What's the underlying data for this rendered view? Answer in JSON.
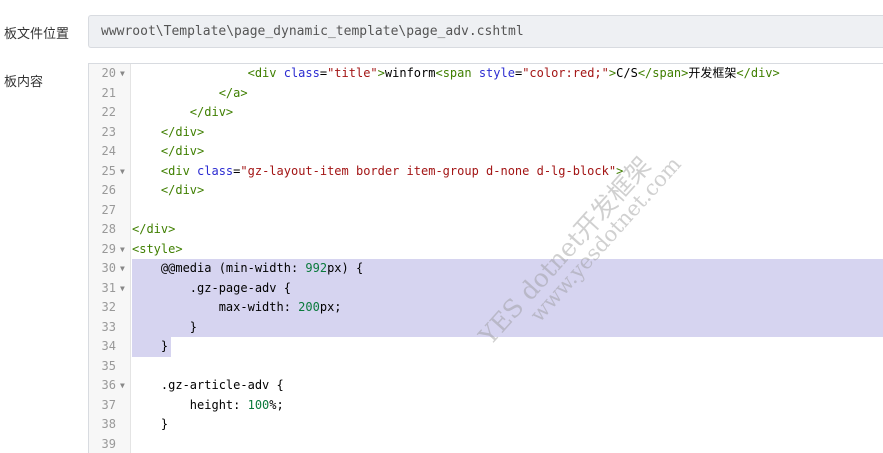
{
  "form": {
    "file_location_label": "板文件位置",
    "file_path": "wwwroot\\Template\\page_dynamic_template\\page_adv.cshtml",
    "content_label": "板内容"
  },
  "editor": {
    "selection_color": "#d6d4f0",
    "lines": [
      {
        "n": "20",
        "fold": true,
        "parts": [
          {
            "c": "t-txt",
            "t": "                "
          },
          {
            "c": "t-tag",
            "t": "<div "
          },
          {
            "c": "t-attr",
            "t": "class"
          },
          {
            "c": "t-txt",
            "t": "="
          },
          {
            "c": "t-str",
            "t": "\"title\""
          },
          {
            "c": "t-tag",
            "t": ">"
          },
          {
            "c": "t-txt",
            "t": "winform"
          },
          {
            "c": "t-tag",
            "t": "<span "
          },
          {
            "c": "t-attr",
            "t": "style"
          },
          {
            "c": "t-txt",
            "t": "="
          },
          {
            "c": "t-str",
            "t": "\"color:red;\""
          },
          {
            "c": "t-tag",
            "t": ">"
          },
          {
            "c": "t-txt",
            "t": "C/S"
          },
          {
            "c": "t-tag",
            "t": "</span>"
          },
          {
            "c": "t-txt",
            "t": "开发框架"
          },
          {
            "c": "t-tag",
            "t": "</div>"
          }
        ]
      },
      {
        "n": "21",
        "fold": false,
        "parts": [
          {
            "c": "t-txt",
            "t": "            "
          },
          {
            "c": "t-tag",
            "t": "</a>"
          }
        ]
      },
      {
        "n": "22",
        "fold": false,
        "parts": [
          {
            "c": "t-txt",
            "t": "        "
          },
          {
            "c": "t-tag",
            "t": "</div>"
          }
        ]
      },
      {
        "n": "23",
        "fold": false,
        "parts": [
          {
            "c": "t-txt",
            "t": "    "
          },
          {
            "c": "t-tag",
            "t": "</div>"
          }
        ]
      },
      {
        "n": "24",
        "fold": false,
        "parts": [
          {
            "c": "t-txt",
            "t": "    "
          },
          {
            "c": "t-tag",
            "t": "</div>"
          }
        ]
      },
      {
        "n": "25",
        "fold": true,
        "parts": [
          {
            "c": "t-txt",
            "t": "    "
          },
          {
            "c": "t-tag",
            "t": "<div "
          },
          {
            "c": "t-attr",
            "t": "class"
          },
          {
            "c": "t-txt",
            "t": "="
          },
          {
            "c": "t-str",
            "t": "\"gz-layout-item border item-group d-none d-lg-block\""
          },
          {
            "c": "t-tag",
            "t": ">"
          }
        ]
      },
      {
        "n": "26",
        "fold": false,
        "parts": [
          {
            "c": "t-txt",
            "t": "    "
          },
          {
            "c": "t-tag",
            "t": "</div>"
          }
        ]
      },
      {
        "n": "27",
        "fold": false,
        "parts": []
      },
      {
        "n": "28",
        "fold": false,
        "parts": [
          {
            "c": "t-tag",
            "t": "</div>"
          }
        ]
      },
      {
        "n": "29",
        "fold": true,
        "parts": [
          {
            "c": "t-tag",
            "t": "<style>"
          }
        ]
      },
      {
        "n": "30",
        "fold": true,
        "sel": true,
        "parts": [
          {
            "c": "t-txt",
            "t": "    @@media (min-width: "
          },
          {
            "c": "t-num",
            "t": "992"
          },
          {
            "c": "t-txt",
            "t": "px) {"
          }
        ]
      },
      {
        "n": "31",
        "fold": true,
        "sel": true,
        "parts": [
          {
            "c": "t-txt",
            "t": "        .gz-page-adv {"
          }
        ]
      },
      {
        "n": "32",
        "fold": false,
        "sel": true,
        "parts": [
          {
            "c": "t-txt",
            "t": "            max-width: "
          },
          {
            "c": "t-num",
            "t": "200"
          },
          {
            "c": "t-txt",
            "t": "px;"
          }
        ]
      },
      {
        "n": "33",
        "fold": false,
        "sel": true,
        "parts": [
          {
            "c": "t-txt",
            "t": "        }"
          }
        ]
      },
      {
        "n": "34",
        "fold": false,
        "sel": "partial",
        "parts": [
          {
            "c": "t-txt",
            "t": "    }"
          }
        ]
      },
      {
        "n": "35",
        "fold": false,
        "parts": []
      },
      {
        "n": "36",
        "fold": true,
        "parts": [
          {
            "c": "t-txt",
            "t": "    .gz-article-adv {"
          }
        ]
      },
      {
        "n": "37",
        "fold": false,
        "parts": [
          {
            "c": "t-txt",
            "t": "        height: "
          },
          {
            "c": "t-num",
            "t": "100"
          },
          {
            "c": "t-txt",
            "t": "%;"
          }
        ]
      },
      {
        "n": "38",
        "fold": false,
        "parts": [
          {
            "c": "t-txt",
            "t": "    }"
          }
        ]
      },
      {
        "n": "39",
        "fold": false,
        "parts": []
      }
    ]
  },
  "watermark": {
    "line1": "YES dotnet开发框架",
    "line2": "www.yesdotnet.com"
  }
}
